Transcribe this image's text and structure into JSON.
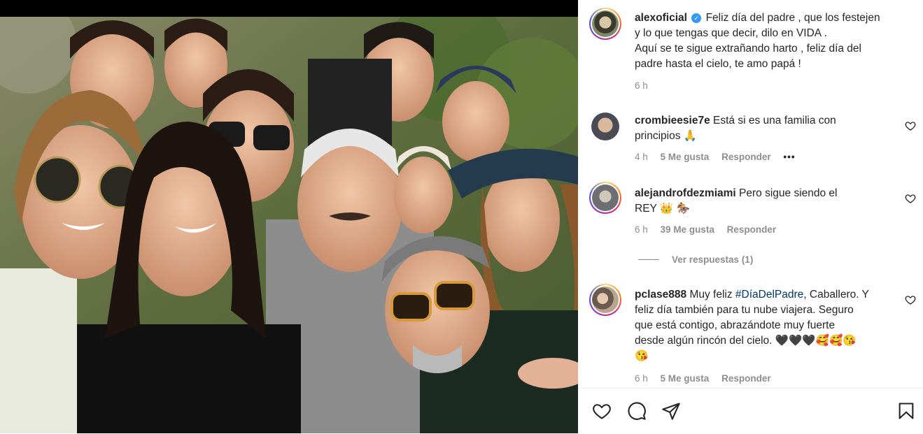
{
  "post": {
    "author": "alexoficial",
    "caption_line1": "Feliz día del padre , que los festejen",
    "caption_line2": "y lo que tengas que decir, dilo en VIDA .",
    "caption_line3": "Aquí se te sigue extrañando harto , feliz día del",
    "caption_line4": "padre hasta el cielo, te amo papá !",
    "time": "6 h"
  },
  "comments": [
    {
      "user": "crombieesie7e",
      "text_line1": "Está si es una familia con",
      "text_line2": "principios 🙏",
      "time": "4 h",
      "likes": "5 Me gusta",
      "reply": "Responder",
      "more": "•••"
    },
    {
      "user": "alejandrofdezmiami",
      "text_line1": "Pero sigue siendo el",
      "text_line2": "REY 👑 🏇",
      "time": "6 h",
      "likes": "39 Me gusta",
      "reply": "Responder",
      "view_replies": "Ver respuestas (1)"
    },
    {
      "user": "pclase888",
      "text_prefix": "Muy feliz",
      "hashtag": "#DíaDelPadre",
      "text_suffix": ", Caballero. Y",
      "text_line2": "feliz día también para tu nube viajera. Seguro",
      "text_line3": "que está contigo, abrazándote muy fuerte",
      "text_line4": "desde algún rincón del cielo. 🖤🖤🖤🥰🥰😘",
      "text_line5": "😘",
      "time": "6 h",
      "likes": "5 Me gusta",
      "reply": "Responder"
    }
  ],
  "icons": {
    "like": "heart-icon",
    "comment": "comment-icon",
    "share": "paper-plane-icon",
    "save": "bookmark-icon"
  },
  "colors": {
    "accent_link": "#00376b",
    "muted": "#8e8e8e",
    "verified": "#3897f0"
  }
}
